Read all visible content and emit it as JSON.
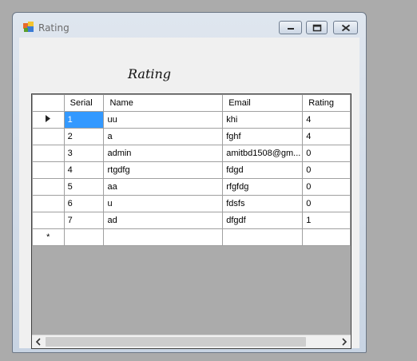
{
  "window": {
    "title": "Rating",
    "icon": "winforms-app-icon",
    "controls": [
      "minimize-icon",
      "maximize-icon",
      "close-icon"
    ]
  },
  "form": {
    "heading": "Rating"
  },
  "grid": {
    "columns": [
      "Serial",
      "Name",
      "Email",
      "Rating"
    ],
    "current_row_marker": "▶",
    "new_row_marker": "*",
    "selected_row": 0,
    "selection_color": "#3399ff",
    "rows": [
      [
        "1",
        "uu",
        "khi",
        "4"
      ],
      [
        "2",
        "a",
        "fghf",
        "4"
      ],
      [
        "3",
        "admin",
        "amitbd1508@gm...",
        "0"
      ],
      [
        "4",
        "rtgdfg",
        "fdgd",
        "0"
      ],
      [
        "5",
        "aa",
        "rfgfdg",
        "0"
      ],
      [
        "6",
        "u",
        "fdsfs",
        "0"
      ],
      [
        "7",
        "ad",
        "dfgdf",
        "1"
      ]
    ]
  },
  "scrollbar": {
    "left_arrow": "‹",
    "right_arrow": "›"
  }
}
